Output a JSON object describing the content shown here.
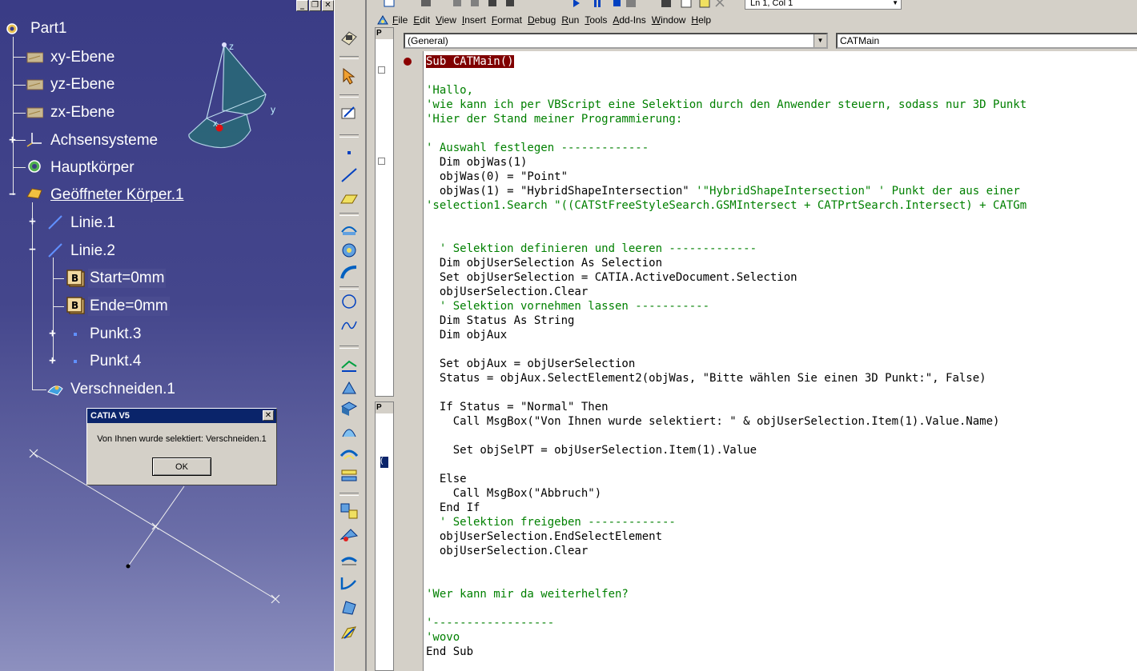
{
  "catia": {
    "tree": [
      {
        "label": "Part1"
      },
      {
        "label": "xy-Ebene"
      },
      {
        "label": "yz-Ebene"
      },
      {
        "label": "zx-Ebene"
      },
      {
        "label": "Achsensysteme"
      },
      {
        "label": "Hauptkörper"
      },
      {
        "label": "Geöffneter Körper.1"
      },
      {
        "label": "Linie.1"
      },
      {
        "label": "Linie.2"
      },
      {
        "label": "Start=0mm"
      },
      {
        "label": "Ende=0mm"
      },
      {
        "label": "Punkt.3"
      },
      {
        "label": "Punkt.4"
      },
      {
        "label": "Verschneiden.1"
      }
    ],
    "axis_labels": {
      "z": "z",
      "y": "y",
      "x": "x"
    },
    "window_buttons": {
      "minimize": "_",
      "restore": "❐",
      "close": "✕"
    }
  },
  "dialog": {
    "title": "CATIA V5",
    "close": "✕",
    "message": "Von Ihnen wurde selektiert: Verschneiden.1",
    "ok": "OK"
  },
  "vba": {
    "position": "Ln 1, Col 1",
    "menu": [
      "File",
      "Edit",
      "View",
      "Insert",
      "Format",
      "Debug",
      "Run",
      "Tools",
      "Add-Ins",
      "Window",
      "Help"
    ],
    "project_labels": {
      "p1": "P",
      "p2": "P",
      "p2_item": "("
    },
    "object_combo": "(General)",
    "procedure_combo": "CATMain",
    "code": [
      {
        "text": "Sub CATMain()",
        "kind": "hl"
      },
      {
        "text": "",
        "kind": "code"
      },
      {
        "text": "'Hallo,",
        "kind": "cmt"
      },
      {
        "text": "'wie kann ich per VBScript eine Selektion durch den Anwender steuern, sodass nur 3D Punkt",
        "kind": "cmt"
      },
      {
        "text": "'Hier der Stand meiner Programmierung:",
        "kind": "cmt"
      },
      {
        "text": "",
        "kind": "code"
      },
      {
        "text": "' Auswahl festlegen -------------",
        "kind": "cmt"
      },
      {
        "text": "  Dim objWas(1)",
        "kind": "code"
      },
      {
        "text": "  objWas(0) = \"Point\"",
        "kind": "code"
      },
      {
        "text": "  objWas(1) = \"HybridShapeIntersection\" '\"HybridShapeIntersection\" ' Punkt der aus einer",
        "kind": "mix",
        "split": 39
      },
      {
        "text": "'selection1.Search \"((CATStFreeStyleSearch.GSMIntersect + CATPrtSearch.Intersect) + CATGm",
        "kind": "cmt"
      },
      {
        "text": "",
        "kind": "code"
      },
      {
        "text": "",
        "kind": "code"
      },
      {
        "text": "  ' Selektion definieren und leeren -------------",
        "kind": "cmt"
      },
      {
        "text": "  Dim objUserSelection As Selection",
        "kind": "code"
      },
      {
        "text": "  Set objUserSelection = CATIA.ActiveDocument.Selection",
        "kind": "code"
      },
      {
        "text": "  objUserSelection.Clear",
        "kind": "code"
      },
      {
        "text": "  ' Selektion vornehmen lassen -----------",
        "kind": "cmt"
      },
      {
        "text": "  Dim Status As String",
        "kind": "code"
      },
      {
        "text": "  Dim objAux",
        "kind": "code"
      },
      {
        "text": "",
        "kind": "code"
      },
      {
        "text": "  Set objAux = objUserSelection",
        "kind": "code"
      },
      {
        "text": "  Status = objAux.SelectElement2(objWas, \"Bitte wählen Sie einen 3D Punkt:\", False)",
        "kind": "code"
      },
      {
        "text": "",
        "kind": "code"
      },
      {
        "text": "  If Status = \"Normal\" Then",
        "kind": "code"
      },
      {
        "text": "    Call MsgBox(\"Von Ihnen wurde selektiert: \" & objUserSelection.Item(1).Value.Name)",
        "kind": "code"
      },
      {
        "text": "",
        "kind": "code"
      },
      {
        "text": "    Set objSelPT = objUserSelection.Item(1).Value",
        "kind": "code"
      },
      {
        "text": "",
        "kind": "code"
      },
      {
        "text": "  Else",
        "kind": "code"
      },
      {
        "text": "    Call MsgBox(\"Abbruch\")",
        "kind": "code"
      },
      {
        "text": "  End If",
        "kind": "code"
      },
      {
        "text": "  ' Selektion freigeben -------------",
        "kind": "cmt"
      },
      {
        "text": "  objUserSelection.EndSelectElement",
        "kind": "code"
      },
      {
        "text": "  objUserSelection.Clear",
        "kind": "code"
      },
      {
        "text": "",
        "kind": "code"
      },
      {
        "text": "",
        "kind": "code"
      },
      {
        "text": "'Wer kann mir da weiterhelfen?",
        "kind": "cmt"
      },
      {
        "text": "",
        "kind": "code"
      },
      {
        "text": "'------------------",
        "kind": "cmt"
      },
      {
        "text": "'wovo",
        "kind": "cmt"
      },
      {
        "text": "End Sub",
        "kind": "code"
      }
    ]
  },
  "colors": {
    "comment": "#008000",
    "highlight_bg": "#800000",
    "catia_bg": "#3a3c86",
    "title_bar": "#0a246a"
  }
}
